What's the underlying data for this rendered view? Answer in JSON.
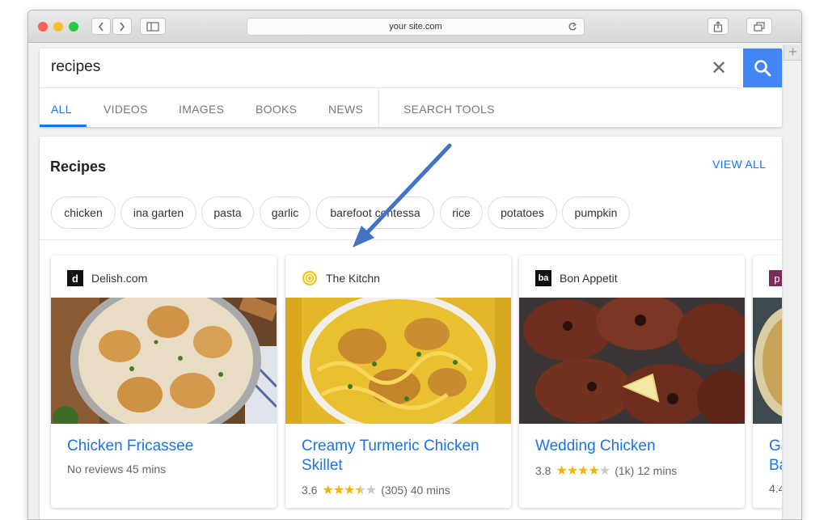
{
  "browser": {
    "url": "your site.com",
    "colors": {
      "close": "#fc5f57",
      "minimize": "#fdbc2e",
      "zoom": "#28c840"
    }
  },
  "search": {
    "query": "recipes",
    "tabs": [
      "ALL",
      "VIDEOS",
      "IMAGES",
      "BOOKS",
      "NEWS"
    ],
    "tools_label": "SEARCH TOOLS",
    "active_tab": "ALL",
    "accent": "#4285f4"
  },
  "recipes": {
    "title": "Recipes",
    "view_all": "VIEW ALL",
    "chips": [
      "chicken",
      "ina garten",
      "pasta",
      "garlic",
      "barefoot contessa",
      "rice",
      "potatoes",
      "pumpkin"
    ],
    "cards": [
      {
        "source": "Delish.com",
        "logo": "d",
        "title": "Chicken Fricassee",
        "reviews_text": "No reviews",
        "time": "45 mins"
      },
      {
        "source": "The Kitchn",
        "logo": "kitchn-icon",
        "title": "Creamy Turmeric Chicken Skillet",
        "rating": "3.6",
        "stars": 3.5,
        "count": "(305)",
        "time": "40 mins"
      },
      {
        "source": "Bon Appetit",
        "logo": "ba",
        "title": "Wedding Chicken",
        "rating": "3.8",
        "stars": 4,
        "count": "(1k)",
        "time": "12 mins"
      },
      {
        "source": "",
        "logo": "p",
        "title_partial_1": "Ga",
        "title_partial_2": "Ba",
        "rating": "4.4"
      }
    ]
  }
}
